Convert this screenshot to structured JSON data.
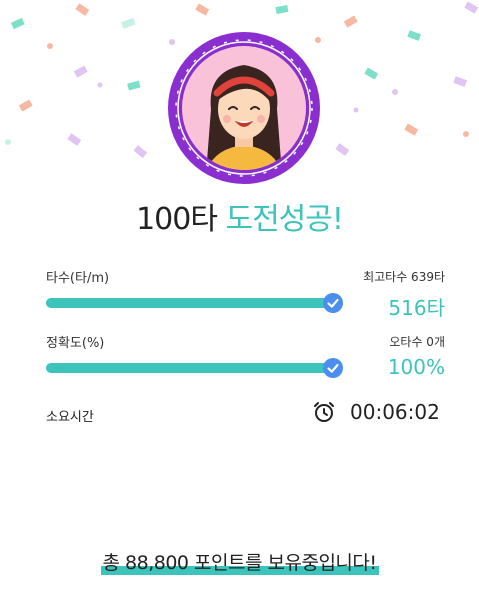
{
  "headline": {
    "count_text": "100타",
    "success_text": "도전성공!"
  },
  "stats": {
    "speed": {
      "label": "타수(타/m)",
      "best_label": "최고타수 639타",
      "value": "516타",
      "progress": 0.97
    },
    "accuracy": {
      "label": "정확도(%)",
      "errors_label": "오타수 0개",
      "value": "100%",
      "progress": 0.97
    }
  },
  "time": {
    "label": "소요시간",
    "value": "00:06:02",
    "icon": "alarm-clock-icon"
  },
  "footer": {
    "points_text": "총 88,800 포인트를 보유중입니다!"
  },
  "colors": {
    "accent": "#3cc3bb",
    "frame": "#8a2ed0",
    "check": "#4a8ef0",
    "avatar_bg": "#f9c2d9"
  }
}
